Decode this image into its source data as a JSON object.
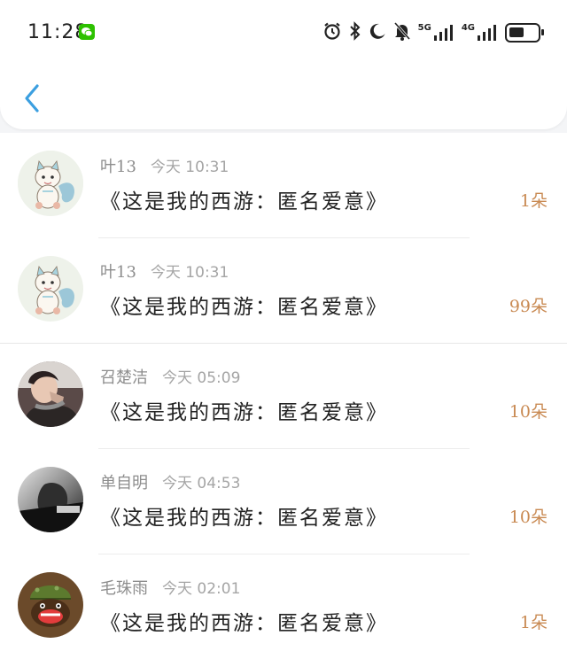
{
  "status_bar": {
    "time": "11:28",
    "network_5g": "5G",
    "network_4g": "4G"
  },
  "header": {
    "back_icon": "chevron-left-icon"
  },
  "gift_list": [
    {
      "sender": "叶13",
      "time": "今天 10:31",
      "title": "《这是我的西游：匿名爱意》",
      "count": "1朵",
      "avatar": "cartoon-tiger"
    },
    {
      "sender": "叶13",
      "time": "今天 10:31",
      "title": "《这是我的西游：匿名爱意》",
      "count": "99朵",
      "avatar": "cartoon-tiger"
    },
    {
      "sender": "召楚洁",
      "time": "今天 05:09",
      "title": "《这是我的西游：匿名爱意》",
      "count": "10朵",
      "avatar": "photo-person"
    },
    {
      "sender": "单自明",
      "time": "今天 04:53",
      "title": "《这是我的西游：匿名爱意》",
      "count": "10朵",
      "avatar": "photo-gray"
    },
    {
      "sender": "毛珠雨",
      "time": "今天 02:01",
      "title": "《这是我的西游：匿名爱意》",
      "count": "1朵",
      "avatar": "cartoon-monkey"
    }
  ],
  "colors": {
    "accent_blue": "#3b9fe0",
    "count_orange": "#c98a53",
    "wechat_green": "#2dc100"
  }
}
